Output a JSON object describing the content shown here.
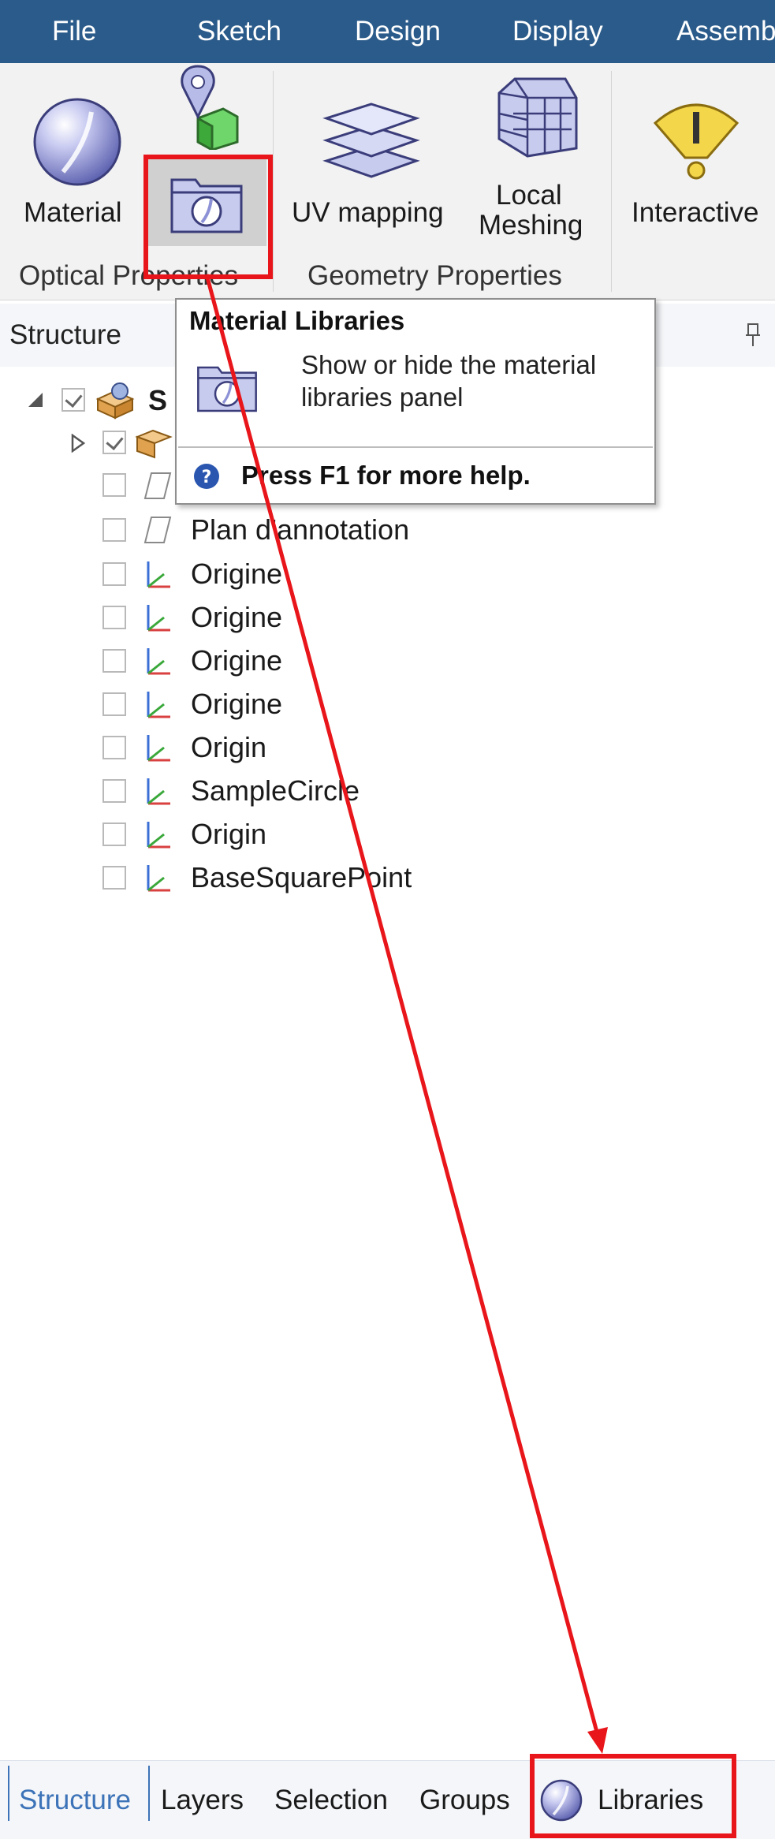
{
  "menubar": {
    "items": [
      "File",
      "Sketch",
      "Design",
      "Display",
      "Assemb"
    ]
  },
  "ribbon": {
    "buttons": {
      "material": "Material",
      "uv_mapping": "UV mapping",
      "local_meshing_1": "Local",
      "local_meshing_2": "Meshing",
      "interactive": "Interactive"
    },
    "groups": {
      "optical": "Optical Properties",
      "geometry": "Geometry Properties"
    }
  },
  "tooltip": {
    "title": "Material Libraries",
    "description": "Show or hide the material libraries panel",
    "help": "Press F1 for more help."
  },
  "structure_panel": {
    "title": "Structure",
    "root_label": "S",
    "rows": [
      "Plan d'annotation",
      "Origine",
      "Origine",
      "Origine",
      "Origine",
      "Origin",
      "SampleCircle",
      "Origin",
      "BaseSquarePoint"
    ]
  },
  "tabs": {
    "structure": "Structure",
    "layers": "Layers",
    "selection": "Selection",
    "groups": "Groups",
    "libraries": "Libraries"
  },
  "colors": {
    "menubar": "#2b5b8a",
    "accent_tab": "#3d73b8",
    "annotation": "#e8161a"
  }
}
